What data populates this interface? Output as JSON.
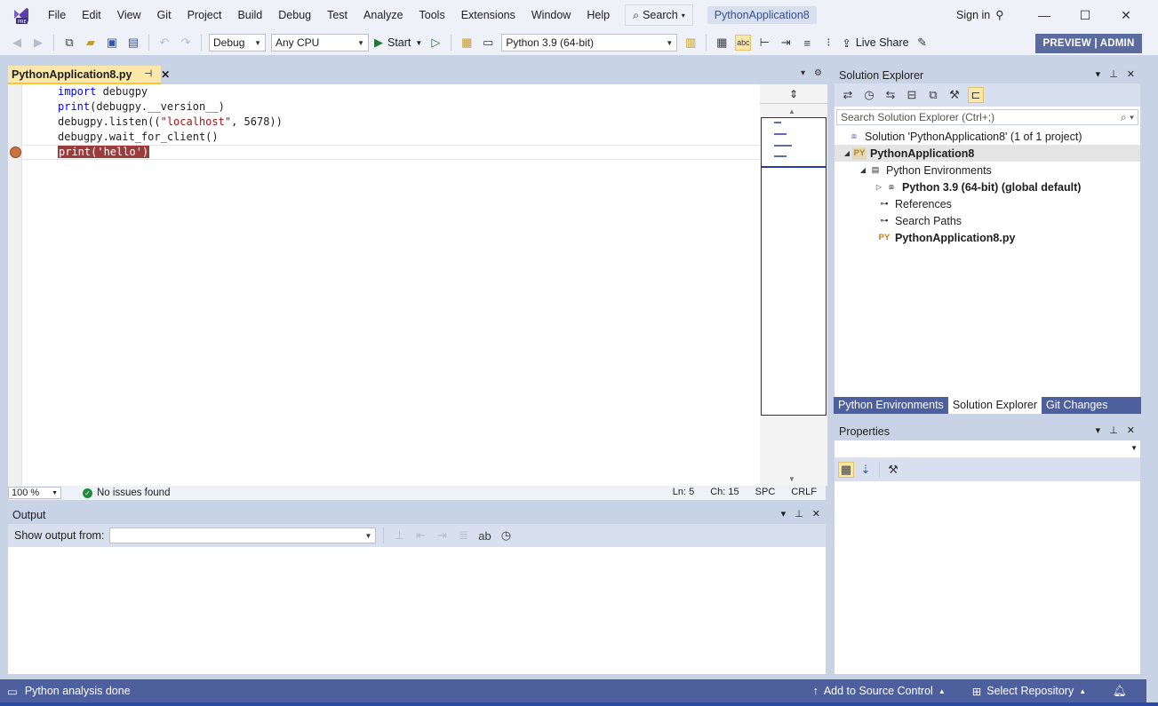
{
  "menu": {
    "items": [
      "File",
      "Edit",
      "View",
      "Git",
      "Project",
      "Build",
      "Debug",
      "Test",
      "Analyze",
      "Tools",
      "Extensions",
      "Window",
      "Help"
    ],
    "search_label": "Search",
    "solution_title": "PythonApplication8",
    "signin_label": "Sign in"
  },
  "toolbar": {
    "config": "Debug",
    "platform": "Any CPU",
    "start_label": "Start",
    "python_env": "Python 3.9 (64-bit)",
    "liveshare_label": "Live Share",
    "preview_label": "PREVIEW | ADMIN"
  },
  "editor": {
    "tab_label": "PythonApplication8.py",
    "lines": [
      {
        "parts": [
          {
            "t": "import",
            "c": "kw"
          },
          {
            "t": " debugpy",
            "c": ""
          }
        ]
      },
      {
        "parts": [
          {
            "t": "print",
            "c": "kw"
          },
          {
            "t": "(debugpy.__version__)",
            "c": ""
          }
        ]
      },
      {
        "parts": [
          {
            "t": "debugpy.listen((",
            "c": ""
          },
          {
            "t": "\"localhost\"",
            "c": "str"
          },
          {
            "t": ", 5678))",
            "c": ""
          }
        ]
      },
      {
        "parts": [
          {
            "t": "debugpy.wait_for_client()",
            "c": ""
          }
        ]
      },
      {
        "parts": [
          {
            "t": "print('hello')",
            "c": "bp"
          }
        ]
      }
    ],
    "zoom": "100 %",
    "issues": "No issues found",
    "line_col": "Ln: 5",
    "char": "Ch: 15",
    "spc": "SPC",
    "eol": "CRLF"
  },
  "output": {
    "title": "Output",
    "show_from_label": "Show output from:",
    "show_from_value": ""
  },
  "solution_explorer": {
    "title": "Solution Explorer",
    "search_placeholder": "Search Solution Explorer (Ctrl+;)",
    "tree": {
      "solution": "Solution 'PythonApplication8' (1 of 1 project)",
      "project": "PythonApplication8",
      "py_badge": "PY",
      "envs": "Python Environments",
      "env_item": "Python 3.9 (64-bit) (global default)",
      "references": "References",
      "search_paths": "Search Paths",
      "file": "PythonApplication8.py"
    },
    "tabs": [
      "Python Environments",
      "Solution Explorer",
      "Git Changes"
    ]
  },
  "properties": {
    "title": "Properties"
  },
  "statusbar": {
    "message": "Python analysis done",
    "source_control": "Add to Source Control",
    "repository": "Select Repository"
  },
  "colors": {
    "accent": "#4d5f9c",
    "tab_active": "#fbe7a8",
    "breakpoint": "#c9743f"
  }
}
